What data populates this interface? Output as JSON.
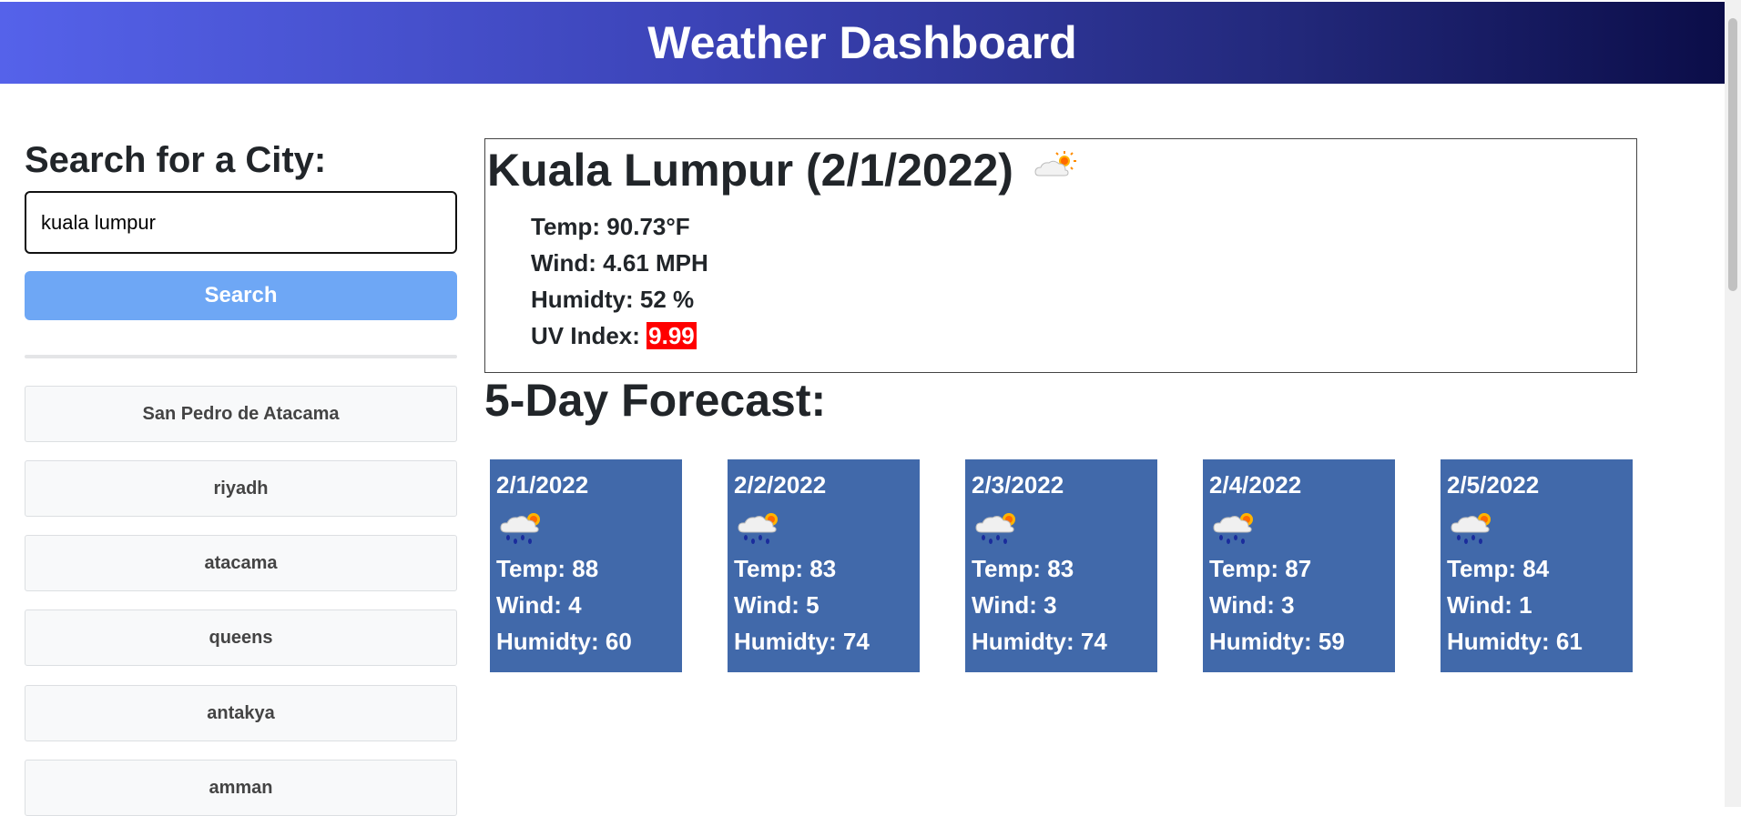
{
  "header": {
    "title": "Weather Dashboard"
  },
  "search": {
    "heading": "Search for a City:",
    "value": "kuala lumpur",
    "button_label": "Search"
  },
  "history": [
    "San Pedro de Atacama",
    "riyadh",
    "atacama",
    "queens",
    "antakya",
    "amman"
  ],
  "current": {
    "title": "Kuala Lumpur (2/1/2022)",
    "icon": "partly-cloudy-icon",
    "temp": "Temp: 90.73°F",
    "wind": "Wind: 4.61 MPH",
    "humidity": "Humidty: 52 %",
    "uv_label": "UV Index:",
    "uv_value": "9.99",
    "uv_color": "#ff0000"
  },
  "forecast": {
    "title": "5-Day Forecast:",
    "card_color": "#4169aa",
    "days": [
      {
        "date": "2/1/2022",
        "icon": "rain-sun-icon",
        "temp": "Temp: 88",
        "wind": "Wind: 4",
        "humidity": "Humidty: 60"
      },
      {
        "date": "2/2/2022",
        "icon": "rain-sun-icon",
        "temp": "Temp: 83",
        "wind": "Wind: 5",
        "humidity": "Humidty: 74"
      },
      {
        "date": "2/3/2022",
        "icon": "rain-sun-icon",
        "temp": "Temp: 83",
        "wind": "Wind: 3",
        "humidity": "Humidty: 74"
      },
      {
        "date": "2/4/2022",
        "icon": "rain-sun-icon",
        "temp": "Temp: 87",
        "wind": "Wind: 3",
        "humidity": "Humidty: 59"
      },
      {
        "date": "2/5/2022",
        "icon": "rain-sun-icon",
        "temp": "Temp: 84",
        "wind": "Wind: 1",
        "humidity": "Humidty: 61"
      }
    ]
  },
  "colors": {
    "search_button": "#6ea7f5",
    "header_start": "#5562ea",
    "header_end": "#0b0d48"
  }
}
